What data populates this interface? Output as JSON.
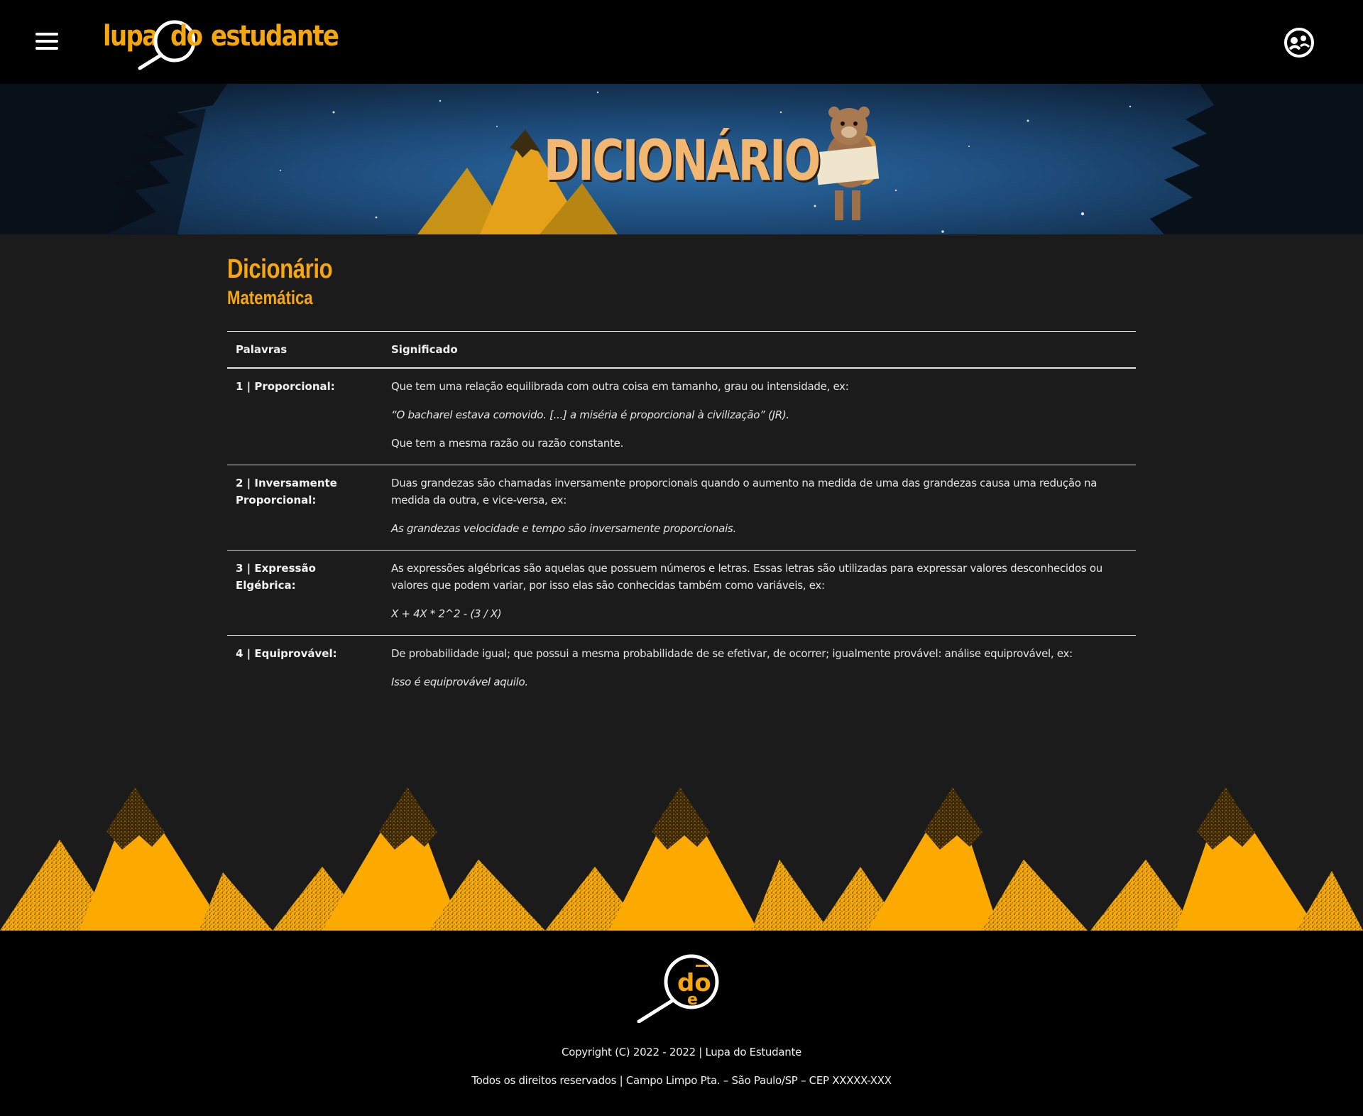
{
  "header": {
    "logo_parts": [
      "lupa",
      "do",
      "estudante"
    ],
    "menu_icon": "hamburger-menu-icon",
    "user_icon": "user-avatar-icon"
  },
  "banner": {
    "title": "DICIONÁRIO"
  },
  "main": {
    "title": "Dicionário",
    "subtitle": "Matemática",
    "table": {
      "headers": [
        "Palavras",
        "Significado"
      ],
      "rows": [
        {
          "word": "1 | Proporcional:",
          "meaning": [
            {
              "text": "Que tem uma relação equilibrada com outra coisa em tamanho, grau ou intensidade, ex:",
              "italic": false
            },
            {
              "text": "“O bacharel estava comovido. [...] a miséria é proporcional à civilização” (JR).",
              "italic": true
            },
            {
              "text": "Que tem a mesma razão ou razão constante.",
              "italic": false
            }
          ]
        },
        {
          "word": "2 | Inversamente Proporcional:",
          "meaning": [
            {
              "text": "Duas grandezas são chamadas inversamente proporcionais quando o aumento na medida de uma das grandezas causa uma redução na medida da outra, e vice-versa, ex:",
              "italic": false
            },
            {
              "text": "As grandezas velocidade e tempo são inversamente proporcionais.",
              "italic": true
            }
          ]
        },
        {
          "word": "3 | Expressão Elgébrica:",
          "meaning": [
            {
              "text": "As expressões algébricas são aquelas que possuem números e letras. Essas letras são utilizadas para expressar valores desconhecidos ou valores que podem variar, por isso elas são conhecidas também como variáveis, ex:",
              "italic": false
            },
            {
              "text": "X + 4X * 2^2 - (3 / X)",
              "italic": true
            }
          ]
        },
        {
          "word": "4 | Equiprovável:",
          "meaning": [
            {
              "text": "De probabilidade igual; que possui a mesma probabilidade de se efetivar, de ocorrer; igualmente provável: análise equiprovável, ex:",
              "italic": false
            },
            {
              "text": "Isso é equiprovável aquilo.",
              "italic": true
            }
          ]
        }
      ]
    }
  },
  "footer": {
    "logo_text": "do e",
    "copyright": "Copyright (C) 2022 - 2022 | Lupa do Estudante",
    "rights": "Todos os direitos reservados | Campo Limpo Pta. – São Paulo/SP – CEP XXXXX-XXX"
  },
  "colors": {
    "accent": "#f7a70e",
    "background": "#1b1b1b",
    "header_bg": "#000000"
  }
}
